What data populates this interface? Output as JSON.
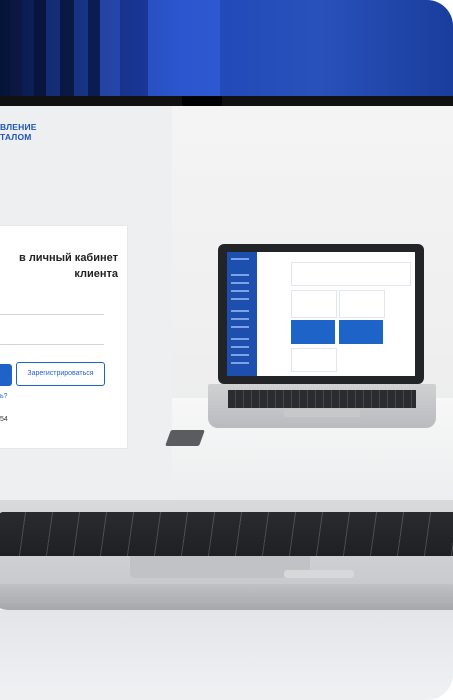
{
  "logo": {
    "line1": "ВЛЕНИЕ",
    "line2": "ТАЛОМ"
  },
  "login": {
    "title_line1": "в личный кабинет",
    "title_line2": "клиента",
    "register_button": "Зарегистрироваться",
    "link_fragment": "ь?",
    "phone_fragment": "54"
  },
  "colors": {
    "brand_blue": "#1f63c8",
    "band_blue": "#1e48b8"
  }
}
